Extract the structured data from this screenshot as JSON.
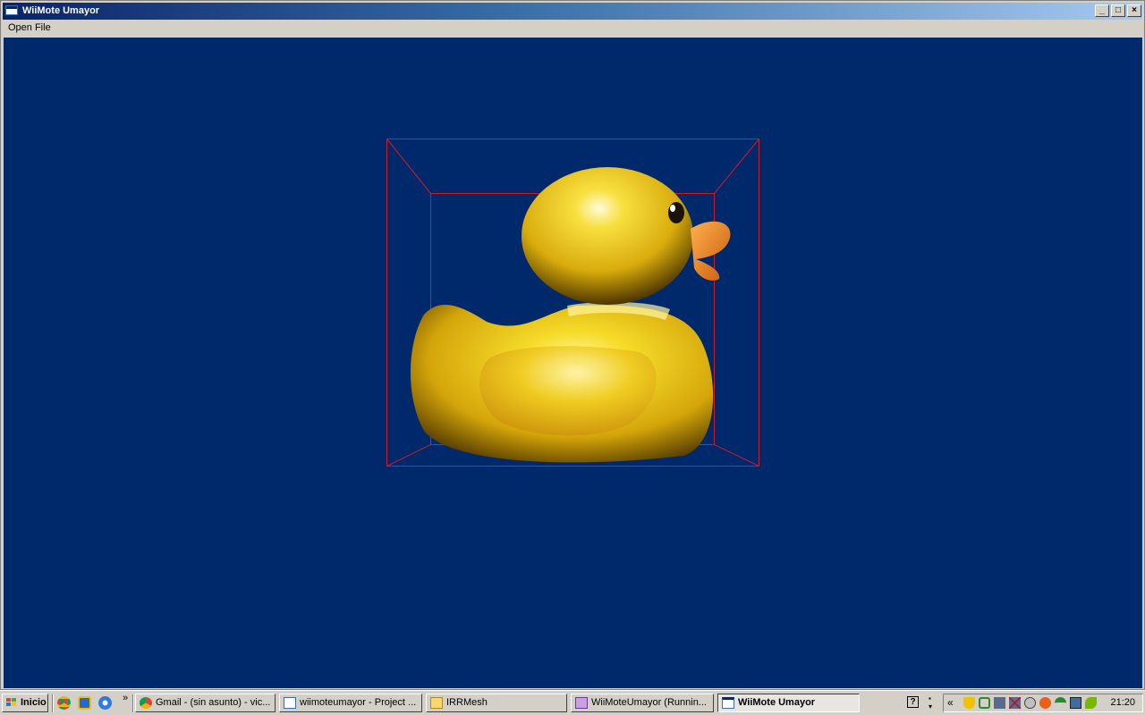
{
  "window": {
    "title": "WiiMote Umayor",
    "minimize_symbol": "_",
    "maximize_symbol": "□",
    "close_symbol": "×"
  },
  "menu": {
    "items": [
      {
        "label": "Open File"
      }
    ]
  },
  "viewport": {
    "background": "#00296b",
    "bounding_box_color": "#cc1a2a",
    "model_color": "#f2cf1a",
    "beak_color": "#ee7a1c",
    "model_icon": "rubber-duck"
  },
  "taskbar": {
    "start_label": "Inicio",
    "quicklaunch": [
      "chrome-icon",
      "ie-icon",
      "media-player-icon"
    ],
    "more_symbol": "»",
    "tasks": [
      {
        "label": "Gmail - (sin asunto) - vic...",
        "icon": "chrome-icon",
        "active": false
      },
      {
        "label": "wiimoteumayor - Project ...",
        "icon": "project-icon",
        "active": false
      },
      {
        "label": "IRRMesh",
        "icon": "folder-icon",
        "active": false
      },
      {
        "label": "WiiMoteUmayor (Runnin...",
        "icon": "ide-icon",
        "active": false
      },
      {
        "label": "WiiMote Umayor",
        "icon": "window-icon",
        "active": true
      }
    ],
    "help_symbol": "?",
    "tray_expand_symbol": "«",
    "clock": "21:20"
  }
}
